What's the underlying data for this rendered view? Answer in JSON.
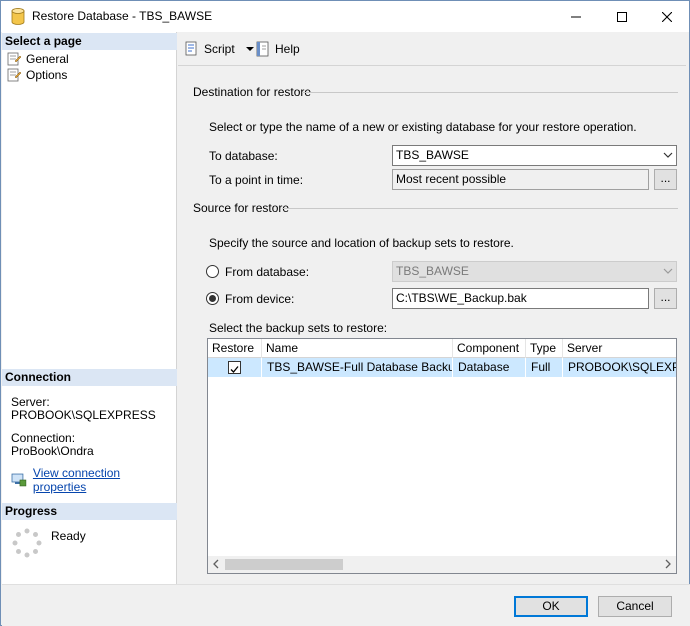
{
  "window": {
    "title": "Restore Database - TBS_BAWSE"
  },
  "left_pane": {
    "select_page_header": "Select a page",
    "pages": [
      {
        "label": "General",
        "icon": "page-icon"
      },
      {
        "label": "Options",
        "icon": "page-icon"
      }
    ],
    "connection_header": "Connection",
    "server_label": "Server:",
    "server_value": "PROBOOK\\SQLEXPRESS",
    "connection_label": "Connection:",
    "connection_value": "ProBook\\Ondra",
    "view_connection_link": "View connection properties",
    "progress_header": "Progress",
    "progress_status": "Ready"
  },
  "toolbar": {
    "script_label": "Script",
    "help_label": "Help"
  },
  "destination": {
    "group_title": "Destination for restore",
    "instruction": "Select or type the name of a new or existing database for your restore operation.",
    "to_database_label": "To database:",
    "to_database_value": "TBS_BAWSE",
    "point_in_time_label": "To a point in time:",
    "point_in_time_value": "Most recent possible",
    "ellipsis": "..."
  },
  "source": {
    "group_title": "Source for restore",
    "instruction": "Specify the source and location of backup sets to restore.",
    "from_database_label": "From database:",
    "from_database_value": "TBS_BAWSE",
    "from_device_label": "From device:",
    "from_device_value": "C:\\TBS\\WE_Backup.bak",
    "ellipsis": "...",
    "selected_option": "From device"
  },
  "backup_sets": {
    "label": "Select the backup sets to restore:",
    "columns": [
      "Restore",
      "Name",
      "Component",
      "Type",
      "Server"
    ],
    "rows": [
      {
        "restore": true,
        "name": "TBS_BAWSE-Full Database Backup",
        "component": "Database",
        "type": "Full",
        "server": "PROBOOK\\SQLEXPRESS"
      }
    ]
  },
  "footer": {
    "ok_label": "OK",
    "cancel_label": "Cancel"
  },
  "colors": {
    "header_bg": "#dbe6f4",
    "row_selected": "#cce8ff",
    "accent": "#0078d7",
    "link": "#0645ad"
  }
}
